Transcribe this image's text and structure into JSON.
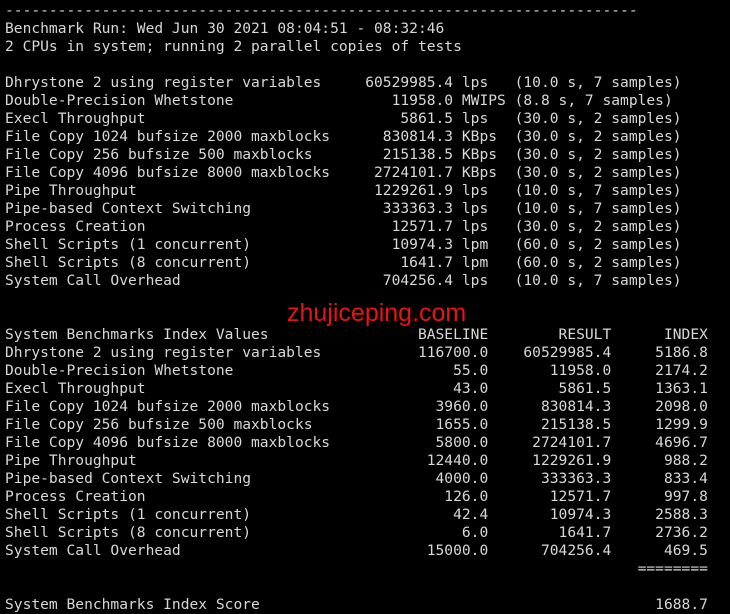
{
  "terminal": {
    "foreground_color": "#d8d8d8",
    "background_color": "#000000",
    "rule_line": "------------------------------------------------------------------------",
    "header": {
      "run_line": "Benchmark Run: Wed Jun 30 2021 08:04:51 - 08:32:46",
      "cpu_line": "2 CPUs in system; running 2 parallel copies of tests"
    },
    "raw_results": {
      "rows": [
        {
          "test": "Dhrystone 2 using register variables",
          "value": "60529985.4",
          "unit": "lps",
          "detail": "(10.0 s, 7 samples)"
        },
        {
          "test": "Double-Precision Whetstone",
          "value": "11958.0",
          "unit": "MWIPS",
          "detail": "(8.8 s, 7 samples)"
        },
        {
          "test": "Execl Throughput",
          "value": "5861.5",
          "unit": "lps",
          "detail": "(30.0 s, 2 samples)"
        },
        {
          "test": "File Copy 1024 bufsize 2000 maxblocks",
          "value": "830814.3",
          "unit": "KBps",
          "detail": "(30.0 s, 2 samples)"
        },
        {
          "test": "File Copy 256 bufsize 500 maxblocks",
          "value": "215138.5",
          "unit": "KBps",
          "detail": "(30.0 s, 2 samples)"
        },
        {
          "test": "File Copy 4096 bufsize 8000 maxblocks",
          "value": "2724101.7",
          "unit": "KBps",
          "detail": "(30.0 s, 2 samples)"
        },
        {
          "test": "Pipe Throughput",
          "value": "1229261.9",
          "unit": "lps",
          "detail": "(10.0 s, 7 samples)"
        },
        {
          "test": "Pipe-based Context Switching",
          "value": "333363.3",
          "unit": "lps",
          "detail": "(10.0 s, 7 samples)"
        },
        {
          "test": "Process Creation",
          "value": "12571.7",
          "unit": "lps",
          "detail": "(30.0 s, 2 samples)"
        },
        {
          "test": "Shell Scripts (1 concurrent)",
          "value": "10974.3",
          "unit": "lpm",
          "detail": "(60.0 s, 2 samples)"
        },
        {
          "test": "Shell Scripts (8 concurrent)",
          "value": "1641.7",
          "unit": "lpm",
          "detail": "(60.0 s, 2 samples)"
        },
        {
          "test": "System Call Overhead",
          "value": "704256.4",
          "unit": "lps",
          "detail": "(10.0 s, 7 samples)"
        }
      ]
    },
    "index_values": {
      "title": "System Benchmarks Index Values",
      "columns": [
        "BASELINE",
        "RESULT",
        "INDEX"
      ],
      "rows": [
        {
          "test": "Dhrystone 2 using register variables",
          "baseline": "116700.0",
          "result": "60529985.4",
          "index": "5186.8"
        },
        {
          "test": "Double-Precision Whetstone",
          "baseline": "55.0",
          "result": "11958.0",
          "index": "2174.2"
        },
        {
          "test": "Execl Throughput",
          "baseline": "43.0",
          "result": "5861.5",
          "index": "1363.1"
        },
        {
          "test": "File Copy 1024 bufsize 2000 maxblocks",
          "baseline": "3960.0",
          "result": "830814.3",
          "index": "2098.0"
        },
        {
          "test": "File Copy 256 bufsize 500 maxblocks",
          "baseline": "1655.0",
          "result": "215138.5",
          "index": "1299.9"
        },
        {
          "test": "File Copy 4096 bufsize 8000 maxblocks",
          "baseline": "5800.0",
          "result": "2724101.7",
          "index": "4696.7"
        },
        {
          "test": "Pipe Throughput",
          "baseline": "12440.0",
          "result": "1229261.9",
          "index": "988.2"
        },
        {
          "test": "Pipe-based Context Switching",
          "baseline": "4000.0",
          "result": "333363.3",
          "index": "833.4"
        },
        {
          "test": "Process Creation",
          "baseline": "126.0",
          "result": "12571.7",
          "index": "997.8"
        },
        {
          "test": "Shell Scripts (1 concurrent)",
          "baseline": "42.4",
          "result": "10974.3",
          "index": "2588.3"
        },
        {
          "test": "Shell Scripts (8 concurrent)",
          "baseline": "6.0",
          "result": "1641.7",
          "index": "2736.2"
        },
        {
          "test": "System Call Overhead",
          "baseline": "15000.0",
          "result": "704256.4",
          "index": "469.5"
        }
      ],
      "separator": "========",
      "score_label": "System Benchmarks Index Score",
      "score_value": "1688.7"
    }
  },
  "watermark": {
    "text": "zhujiceping.com",
    "color": "#e81313"
  }
}
